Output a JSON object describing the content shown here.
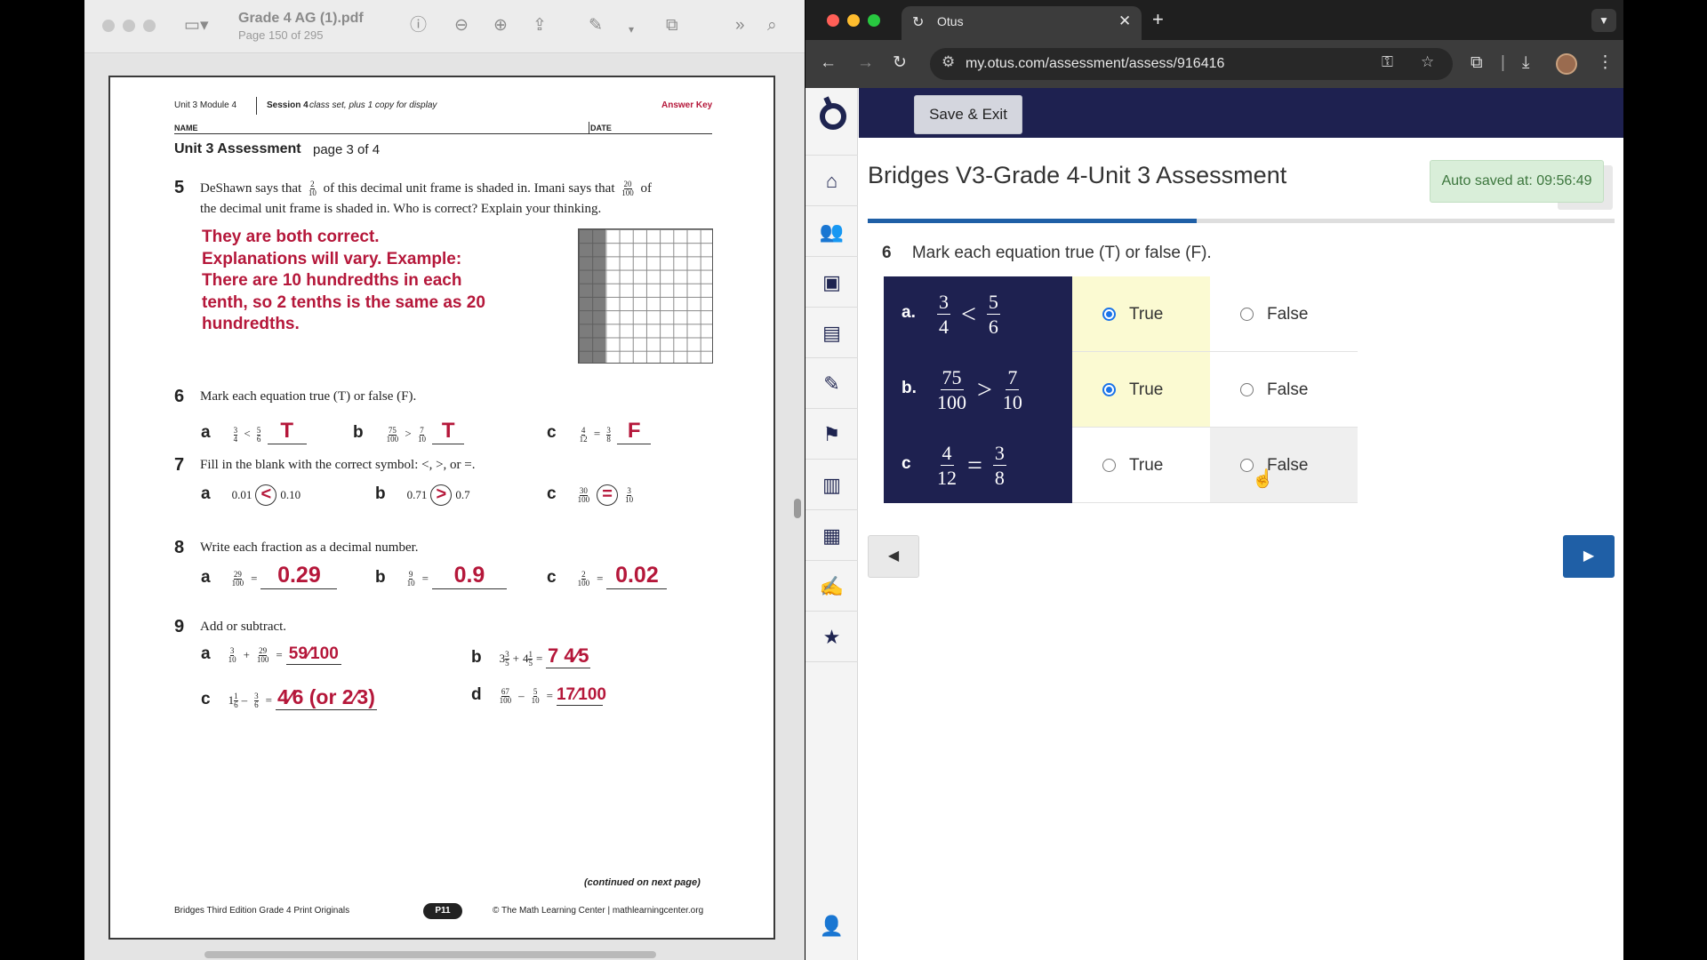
{
  "pdf": {
    "filename": "Grade 4 AG (1).pdf",
    "page_info": "Page 150 of 295",
    "page": {
      "header_unit": "Unit 3 Module 4",
      "header_session": "Session 4",
      "header_session_note": "class set, plus 1 copy for display",
      "answer_key": "Answer Key",
      "name_label": "NAME",
      "date_label": "DATE",
      "title": "Unit 3 Assessment",
      "title_page": "page 3 of 4",
      "q5": {
        "num": "5",
        "text_a": "DeShawn says that",
        "frac1_num": "2",
        "frac1_den": "10",
        "text_b": "of this decimal unit frame is shaded in. Imani says that",
        "frac2_num": "20",
        "frac2_den": "100",
        "text_c": "of",
        "line2": "the decimal unit frame is shaded in. Who is correct? Explain your thinking.",
        "answer_lines": [
          "They are both correct.",
          "Explanations will vary. Example:",
          "There are 10 hundredths in each",
          "tenth, so 2 tenths is the same as 20",
          "hundredths."
        ]
      },
      "q6": {
        "num": "6",
        "text": "Mark each equation true (T) or false (F).",
        "items": [
          {
            "label": "a",
            "n1": "3",
            "d1": "4",
            "op": "<",
            "n2": "5",
            "d2": "6",
            "answer": "T"
          },
          {
            "label": "b",
            "n1": "75",
            "d1": "100",
            "op": ">",
            "n2": "7",
            "d2": "10",
            "answer": "T"
          },
          {
            "label": "c",
            "n1": "4",
            "d1": "12",
            "op": "=",
            "n2": "3",
            "d2": "8",
            "answer": "F"
          }
        ]
      },
      "q7": {
        "num": "7",
        "text": "Fill in the blank with the correct symbol: <, >, or =.",
        "items": [
          {
            "label": "a",
            "left": "0.01",
            "sym": "<",
            "right": "0.10"
          },
          {
            "label": "b",
            "left": "0.71",
            "sym": ">",
            "right": "0.7"
          },
          {
            "label": "c",
            "left_num": "30",
            "left_den": "100",
            "sym": "=",
            "right_num": "3",
            "right_den": "10"
          }
        ]
      },
      "q8": {
        "num": "8",
        "text": "Write each fraction as a decimal number.",
        "items": [
          {
            "label": "a",
            "num": "29",
            "den": "100",
            "answer": "0.29"
          },
          {
            "label": "b",
            "num": "9",
            "den": "10",
            "answer": "0.9"
          },
          {
            "label": "c",
            "num": "2",
            "den": "100",
            "answer": "0.02"
          }
        ]
      },
      "q9": {
        "num": "9",
        "text": "Add or subtract.",
        "a_label": "a",
        "a_expr_1n": "3",
        "a_expr_1d": "10",
        "a_op": "+",
        "a_expr_2n": "29",
        "a_expr_2d": "100",
        "a_answer": "59⁄100",
        "b_label": "b",
        "b_whole1": "3",
        "b_n1": "3",
        "b_d1": "5",
        "b_op": "+",
        "b_whole2": "4",
        "b_n2": "1",
        "b_d2": "5",
        "b_answer": "7 4⁄5",
        "c_label": "c",
        "c_whole1": "1",
        "c_n1": "1",
        "c_d1": "6",
        "c_op": "–",
        "c_n2": "3",
        "c_d2": "6",
        "c_answer": "4⁄6 (or 2⁄3)",
        "d_label": "d",
        "d_n1": "67",
        "d_d1": "100",
        "d_op": "–",
        "d_n2": "5",
        "d_d2": "10",
        "d_answer": "17⁄100"
      },
      "continued": "(continued on next page)",
      "footer_left": "Bridges Third Edition Grade 4 Print Originals",
      "footer_page": "P11",
      "footer_right": "© The Math Learning Center | mathlearningcenter.org"
    }
  },
  "browser": {
    "tab_title": "Otus",
    "url": "my.otus.com/assessment/assess/916416",
    "app": {
      "save_exit": "Save & Exit",
      "title": "Bridges V3-Grade 4-Unit 3 Assessment",
      "autosave": "Auto saved at: 09:56:49",
      "progress_pct": 44,
      "question_num": "6",
      "question_text": "Mark each equation true (T) or false (F).",
      "rows": [
        {
          "label": "a.",
          "n1": "3",
          "d1": "4",
          "op": "<",
          "n2": "5",
          "d2": "6",
          "true_label": "True",
          "false_label": "False",
          "selected": "true"
        },
        {
          "label": "b.",
          "n1": "75",
          "d1": "100",
          "op": ">",
          "n2": "7",
          "d2": "10",
          "true_label": "True",
          "false_label": "False",
          "selected": "true"
        },
        {
          "label": "c",
          "n1": "4",
          "d1": "12",
          "op": "=",
          "n2": "3",
          "d2": "8",
          "true_label": "True",
          "false_label": "False",
          "selected": "none"
        }
      ],
      "colors": {
        "navy": "#1e2150",
        "accent_blue": "#1f5fa6",
        "selected_bg": "#fbfad2",
        "hover_bg": "#efefef",
        "autosave_bg": "#d9eed9"
      }
    },
    "sidebar_icons": [
      "otus-logo-icon",
      "home-icon",
      "users-icon",
      "teacher-board-icon",
      "book-icon",
      "compass-icon",
      "bookmark-icon",
      "map-icon",
      "document-icon",
      "edit-icon",
      "star-icon",
      "user-icon"
    ]
  }
}
